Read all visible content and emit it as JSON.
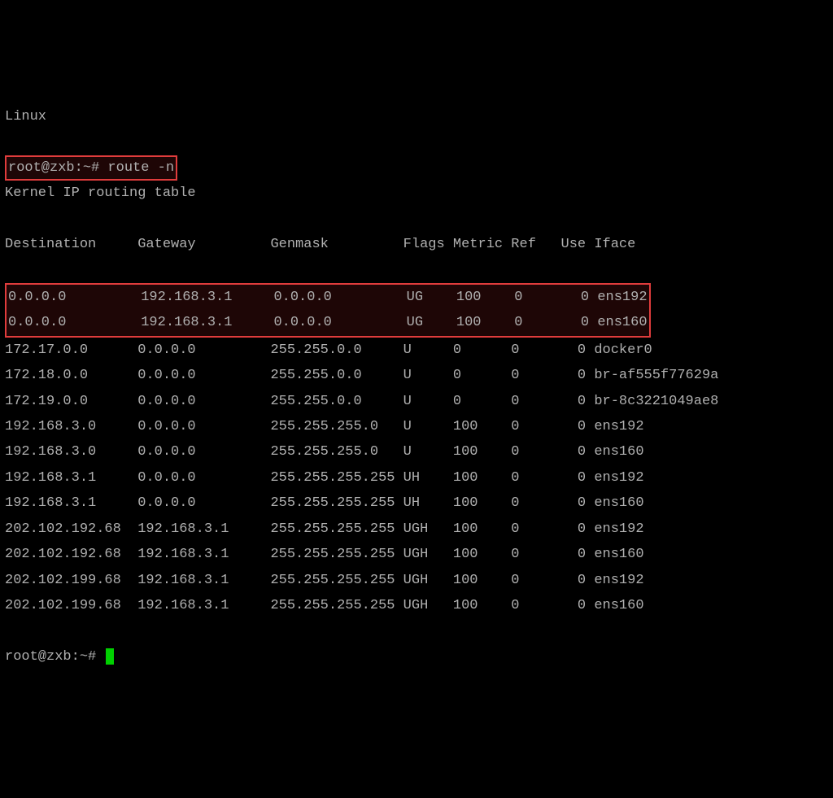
{
  "os_line": "Linux",
  "prompt": "root@zxb:~#",
  "command": "route -n",
  "title": "Kernel IP routing table",
  "headers": {
    "dest": "Destination",
    "gateway": "Gateway",
    "genmask": "Genmask",
    "flags": "Flags",
    "metric": "Metric",
    "ref": "Ref",
    "use": "Use",
    "iface": "Iface"
  },
  "highlighted_rows": [
    {
      "dest": "0.0.0.0",
      "gateway": "192.168.3.1",
      "genmask": "0.0.0.0",
      "flags": "UG",
      "metric": "100",
      "ref": "0",
      "use": "0",
      "iface": "ens192"
    },
    {
      "dest": "0.0.0.0",
      "gateway": "192.168.3.1",
      "genmask": "0.0.0.0",
      "flags": "UG",
      "metric": "100",
      "ref": "0",
      "use": "0",
      "iface": "ens160"
    }
  ],
  "rows": [
    {
      "dest": "172.17.0.0",
      "gateway": "0.0.0.0",
      "genmask": "255.255.0.0",
      "flags": "U",
      "metric": "0",
      "ref": "0",
      "use": "0",
      "iface": "docker0"
    },
    {
      "dest": "172.18.0.0",
      "gateway": "0.0.0.0",
      "genmask": "255.255.0.0",
      "flags": "U",
      "metric": "0",
      "ref": "0",
      "use": "0",
      "iface": "br-af555f77629a"
    },
    {
      "dest": "172.19.0.0",
      "gateway": "0.0.0.0",
      "genmask": "255.255.0.0",
      "flags": "U",
      "metric": "0",
      "ref": "0",
      "use": "0",
      "iface": "br-8c3221049ae8"
    },
    {
      "dest": "192.168.3.0",
      "gateway": "0.0.0.0",
      "genmask": "255.255.255.0",
      "flags": "U",
      "metric": "100",
      "ref": "0",
      "use": "0",
      "iface": "ens192"
    },
    {
      "dest": "192.168.3.0",
      "gateway": "0.0.0.0",
      "genmask": "255.255.255.0",
      "flags": "U",
      "metric": "100",
      "ref": "0",
      "use": "0",
      "iface": "ens160"
    },
    {
      "dest": "192.168.3.1",
      "gateway": "0.0.0.0",
      "genmask": "255.255.255.255",
      "flags": "UH",
      "metric": "100",
      "ref": "0",
      "use": "0",
      "iface": "ens192"
    },
    {
      "dest": "192.168.3.1",
      "gateway": "0.0.0.0",
      "genmask": "255.255.255.255",
      "flags": "UH",
      "metric": "100",
      "ref": "0",
      "use": "0",
      "iface": "ens160"
    },
    {
      "dest": "202.102.192.68",
      "gateway": "192.168.3.1",
      "genmask": "255.255.255.255",
      "flags": "UGH",
      "metric": "100",
      "ref": "0",
      "use": "0",
      "iface": "ens192"
    },
    {
      "dest": "202.102.192.68",
      "gateway": "192.168.3.1",
      "genmask": "255.255.255.255",
      "flags": "UGH",
      "metric": "100",
      "ref": "0",
      "use": "0",
      "iface": "ens160"
    },
    {
      "dest": "202.102.199.68",
      "gateway": "192.168.3.1",
      "genmask": "255.255.255.255",
      "flags": "UGH",
      "metric": "100",
      "ref": "0",
      "use": "0",
      "iface": "ens192"
    },
    {
      "dest": "202.102.199.68",
      "gateway": "192.168.3.1",
      "genmask": "255.255.255.255",
      "flags": "UGH",
      "metric": "100",
      "ref": "0",
      "use": "0",
      "iface": "ens160"
    }
  ],
  "prompt2": "root@zxb:~#"
}
